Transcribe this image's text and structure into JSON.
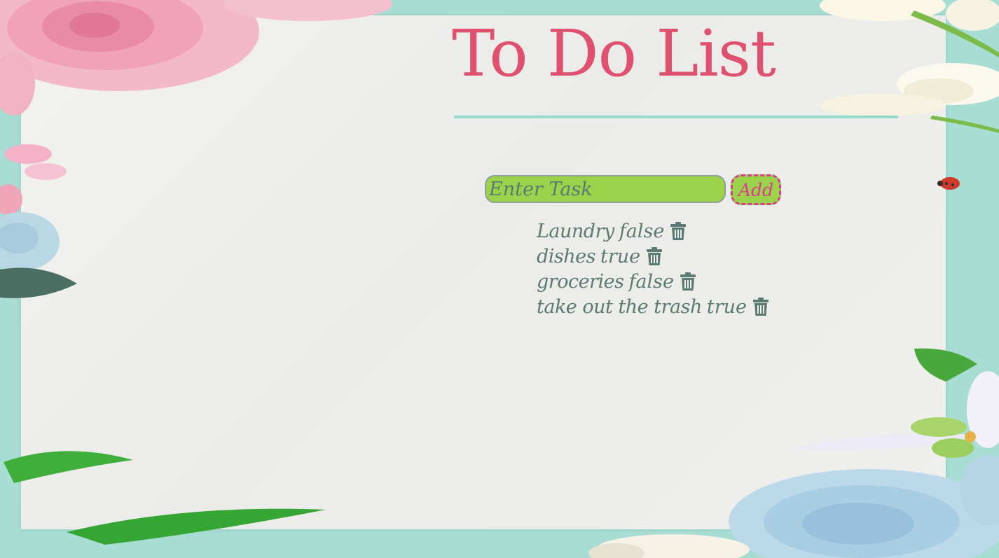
{
  "app": {
    "title": "To Do List"
  },
  "form": {
    "input_placeholder": "Enter Task",
    "input_value": "",
    "add_label": "Add"
  },
  "tasks": [
    {
      "name": "Laundry",
      "done": "false",
      "icon": "trash-icon"
    },
    {
      "name": "dishes",
      "done": "true",
      "icon": "trash-icon"
    },
    {
      "name": "groceries",
      "done": "false",
      "icon": "trash-icon"
    },
    {
      "name": "take out the trash",
      "done": "true",
      "icon": "trash-icon"
    }
  ],
  "colors": {
    "background": "#a7ddd3",
    "paper": "#eeeeec",
    "title": "#e0506f",
    "rule": "#96dccf",
    "input_bg": "#9cd14a",
    "button_border": "#d6408a",
    "task_text": "#5b7a72"
  }
}
